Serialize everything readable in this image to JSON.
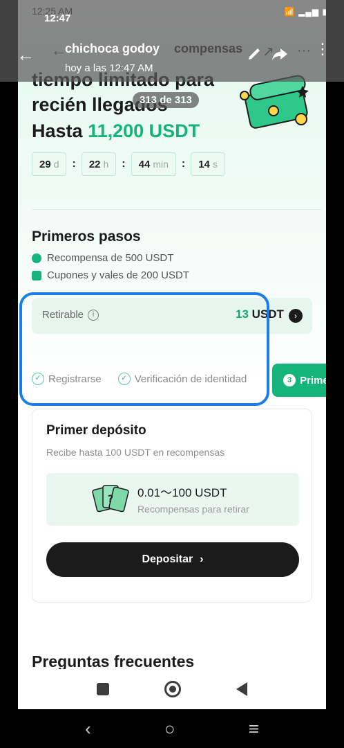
{
  "status_bar": {
    "under_time": "12:25 AM",
    "time": "12:47",
    "battery": "42"
  },
  "viewer": {
    "sender": "chichoca godoy",
    "sent_time": "hoy a las 12:47 AM",
    "counter": "313 de 313"
  },
  "app_header": {
    "title": "compensas"
  },
  "hero": {
    "line1": "tiempo limitado para",
    "line2": "recién llegados",
    "line3_prefix": "Hasta",
    "line3_amount": "11,200 USDT"
  },
  "timer": [
    {
      "value": "29",
      "unit": "d"
    },
    {
      "value": "22",
      "unit": "h"
    },
    {
      "value": "44",
      "unit": "min"
    },
    {
      "value": "14",
      "unit": "s"
    }
  ],
  "first_steps": {
    "title": "Primeros pasos",
    "bullet1": "Recompensa de 500 USDT",
    "bullet2": "Cupones y vales de 200 USDT"
  },
  "retirable": {
    "label": "Retirable",
    "value": "13",
    "unit": "USDT"
  },
  "steps": {
    "step1": "Registrarse",
    "step2": "Verificación de identidad",
    "step3_num": "3",
    "step3_label": "Prime"
  },
  "deposit_card": {
    "title": "Primer depósito",
    "subtitle": "Recibe hasta 100 USDT en recompensas",
    "amount": "0.01～100 USDT",
    "amount_desc": "Recompensas para retirar",
    "button": "Depositar"
  },
  "faq": {
    "title": "Preguntas frecuentes"
  },
  "colors": {
    "accent": "#15b47b",
    "highlight": "#1b7ee8",
    "dark": "#1b1b1b"
  }
}
